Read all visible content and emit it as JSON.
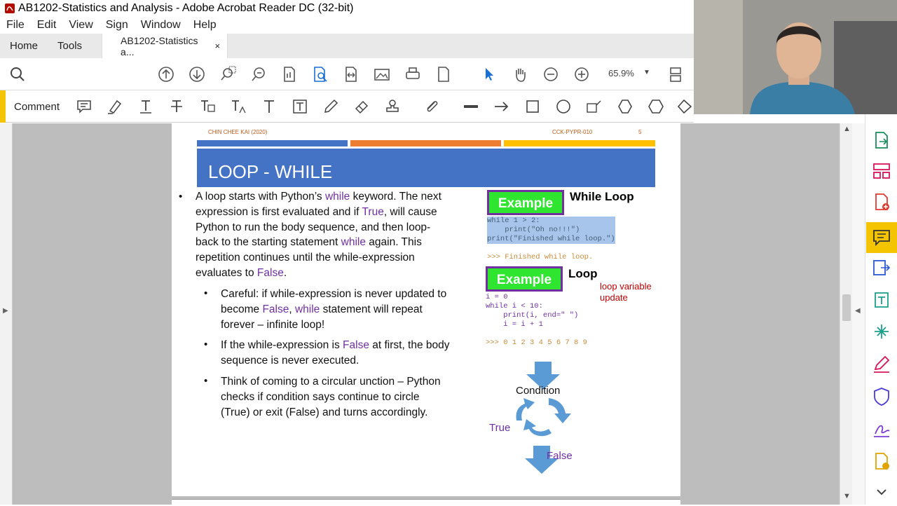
{
  "window": {
    "title": "AB1202-Statistics and Analysis - Adobe Acrobat Reader DC (32-bit)"
  },
  "menu": [
    "File",
    "Edit",
    "View",
    "Sign",
    "Window",
    "Help"
  ],
  "tabs": {
    "home": "Home",
    "tools": "Tools",
    "document": "AB1202-Statistics a...",
    "close": "×"
  },
  "toolbar": {
    "zoom_value": "65.9%",
    "icons": [
      "search-icon",
      "prev-page-icon",
      "next-page-icon",
      "zoom-marquee-icon",
      "zoom-pan-icon",
      "page-thumbnail-icon",
      "find-text-icon",
      "fit-width-icon",
      "image-icon",
      "print-icon",
      "page-icon",
      "select-pointer-icon",
      "hand-tool-icon",
      "zoom-out-icon",
      "zoom-in-icon",
      "page-display-icon"
    ]
  },
  "commentbar": {
    "label": "Comment",
    "icons": [
      "sticky-note-icon",
      "highlight-icon",
      "underline-text-icon",
      "strikethrough-icon",
      "replace-text-icon",
      "insert-text-icon",
      "add-text-icon",
      "text-box-icon",
      "pencil-icon",
      "eraser-icon",
      "stamp-icon",
      "attach-icon",
      "line-icon",
      "arrow-icon",
      "rectangle-icon",
      "oval-icon",
      "text-callout-icon",
      "polygon-icon",
      "cloud-icon",
      "polygon-line-icon"
    ]
  },
  "right_panel": {
    "icons": [
      "export-pdf-icon",
      "organize-pages-icon",
      "create-pdf-icon",
      "comment-icon",
      "export-icon",
      "edit-pdf-icon",
      "combine-icon",
      "fill-sign-icon",
      "protect-icon",
      "send-signature-icon",
      "more-tools-icon"
    ]
  },
  "slide": {
    "author": "CHIN CHEE KAI (2020)",
    "code": "CCK-PYPR-010",
    "page_number": "5",
    "title": "LOOP - WHILE",
    "colors": {
      "blue": "#4472c4",
      "orange": "#ed7d31",
      "gold": "#ffc000",
      "keyword": "#7030a0"
    },
    "main_bullet": [
      {
        "t": "A loop starts with Python’s "
      },
      {
        "t": "while",
        "k": 1
      },
      {
        "t": " keyword. The next"
      },
      {
        "br": 1
      },
      {
        "t": "expression is first evaluated and if "
      },
      {
        "t": "True",
        "k": 1
      },
      {
        "t": ", will cause"
      },
      {
        "br": 1
      },
      {
        "t": "Python to run the body sequence, and then loop-"
      },
      {
        "br": 1
      },
      {
        "t": "back to the starting statement "
      },
      {
        "t": "while",
        "k": 1
      },
      {
        "t": " again.  This"
      },
      {
        "br": 1
      },
      {
        "t": "repetition continues until the while-expression"
      },
      {
        "br": 1
      },
      {
        "t": "evaluates to "
      },
      {
        "t": "False",
        "k": 1
      },
      {
        "t": "."
      }
    ],
    "sub_bullet_1": [
      {
        "t": "Careful:  if while-expression is never updated to"
      },
      {
        "br": 1
      },
      {
        "t": "become "
      },
      {
        "t": "False",
        "k": 1
      },
      {
        "t": ", "
      },
      {
        "t": "while",
        "k": 1
      },
      {
        "t": " statement will repeat"
      },
      {
        "br": 1
      },
      {
        "t": "forever – infinite loop!"
      }
    ],
    "sub_bullet_2": [
      {
        "t": "If the while-expression is "
      },
      {
        "t": "False",
        "k": 1
      },
      {
        "t": " at first, the body"
      },
      {
        "br": 1
      },
      {
        "t": "sequence is never executed."
      }
    ],
    "sub_bullet_3": [
      {
        "t": "Think of coming to a circular unction – Python"
      },
      {
        "br": 1
      },
      {
        "t": "checks if condition says continue to circle"
      },
      {
        "br": 1
      },
      {
        "t": "(True) or exit (False) and turns accordingly."
      }
    ],
    "example_label": "Example",
    "example1_heading": "While Loop",
    "example1_code": "while 1 > 2:\n    print(\"Oh no!!!\")\nprint(\"Finished while loop.\")",
    "example1_output": ">>> Finished while loop.",
    "example2_heading": "Loop",
    "example2_note": "loop variable\nupdate",
    "example2_code": "i = 0\nwhile i < 10:\n    print(i, end=\" \")\n    i = i + 1",
    "example2_output": ">>> 0 1 2 3 4 5 6 7 8 9",
    "flow": {
      "condition": "Condition",
      "true": "True",
      "false": "False"
    }
  }
}
